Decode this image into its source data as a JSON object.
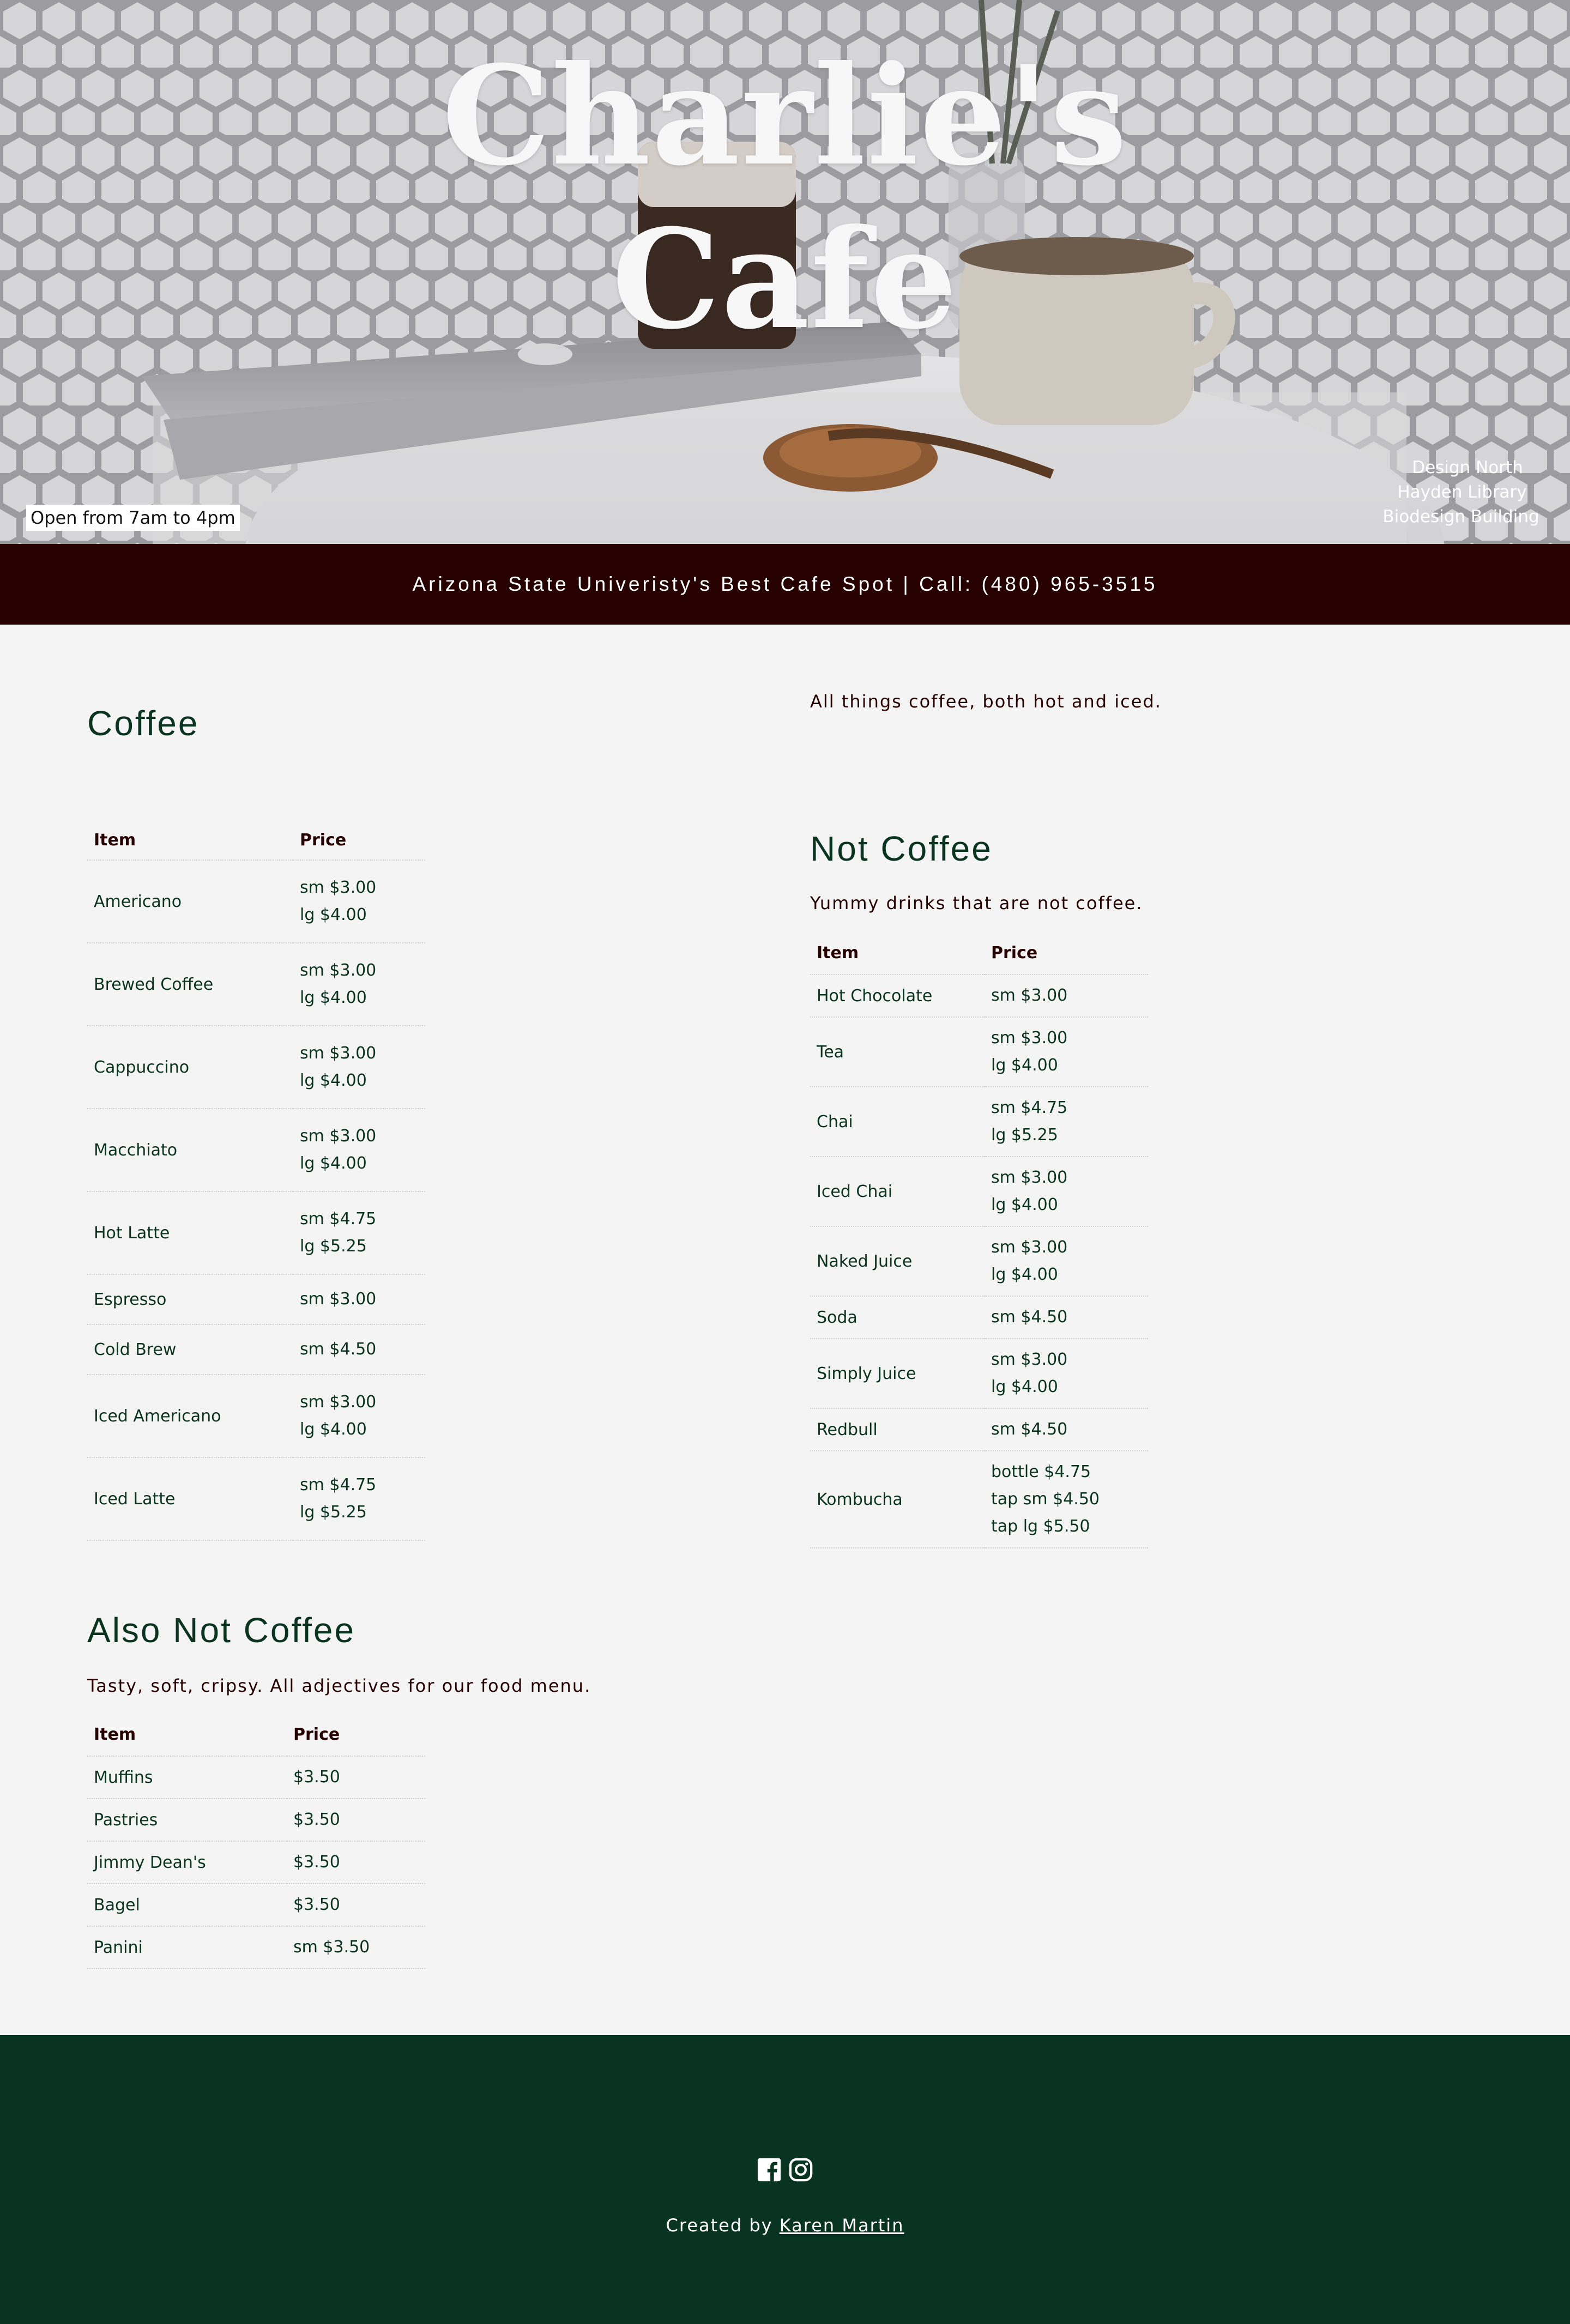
{
  "hero": {
    "title_line1": "Charlie's",
    "title_line2": "Cafe",
    "hours": "Open from 7am to 4pm",
    "locations": [
      "Design North",
      "Hayden Library",
      "Biodesign Building"
    ]
  },
  "banner": {
    "text": "Arizona State Univeristy's Best Cafe Spot | Call: (480) 965-3515"
  },
  "coffee": {
    "heading": "Coffee",
    "description": "All things coffee, both hot and iced.",
    "col_item": "Item",
    "col_price": "Price",
    "rows": [
      {
        "item": "Americano",
        "prices": [
          "sm $3.00",
          "lg $4.00"
        ]
      },
      {
        "item": "Brewed Coffee",
        "prices": [
          "sm $3.00",
          "lg $4.00"
        ]
      },
      {
        "item": "Cappuccino",
        "prices": [
          "sm $3.00",
          "lg $4.00"
        ]
      },
      {
        "item": "Macchiato",
        "prices": [
          "sm $3.00",
          "lg $4.00"
        ]
      },
      {
        "item": "Hot Latte",
        "prices": [
          "sm $4.75",
          "lg $5.25"
        ]
      },
      {
        "item": "Espresso",
        "prices": [
          "sm $3.00"
        ]
      },
      {
        "item": "Cold Brew",
        "prices": [
          "sm $4.50"
        ]
      },
      {
        "item": "Iced Americano",
        "prices": [
          "sm $3.00",
          "lg $4.00"
        ]
      },
      {
        "item": "Iced Latte",
        "prices": [
          "sm $4.75",
          "lg $5.25"
        ]
      }
    ]
  },
  "not_coffee": {
    "heading": "Not Coffee",
    "description": "Yummy drinks that are not coffee.",
    "col_item": "Item",
    "col_price": "Price",
    "rows": [
      {
        "item": "Hot Chocolate",
        "prices": [
          "sm $3.00"
        ]
      },
      {
        "item": "Tea",
        "prices": [
          "sm $3.00",
          "lg $4.00"
        ]
      },
      {
        "item": "Chai",
        "prices": [
          "sm $4.75",
          "lg $5.25"
        ]
      },
      {
        "item": "Iced Chai",
        "prices": [
          "sm $3.00",
          "lg $4.00"
        ]
      },
      {
        "item": "Naked Juice",
        "prices": [
          "sm $3.00",
          "lg $4.00"
        ]
      },
      {
        "item": "Soda",
        "prices": [
          "sm $4.50"
        ]
      },
      {
        "item": "Simply Juice",
        "prices": [
          "sm $3.00",
          "lg $4.00"
        ]
      },
      {
        "item": "Redbull",
        "prices": [
          "sm $4.50"
        ]
      },
      {
        "item": "Kombucha",
        "prices": [
          "bottle $4.75",
          "tap sm $4.50",
          "tap lg $5.50"
        ]
      }
    ]
  },
  "food": {
    "heading": "Also Not Coffee",
    "description": "Tasty, soft, cripsy. All adjectives for our food menu.",
    "col_item": "Item",
    "col_price": "Price",
    "rows": [
      {
        "item": "Muffins",
        "prices": [
          "$3.50"
        ]
      },
      {
        "item": "Pastries",
        "prices": [
          "$3.50"
        ]
      },
      {
        "item": "Jimmy Dean's",
        "prices": [
          "$3.50"
        ]
      },
      {
        "item": "Bagel",
        "prices": [
          "$3.50"
        ]
      },
      {
        "item": "Panini",
        "prices": [
          "sm $3.50"
        ]
      }
    ]
  },
  "footer": {
    "credit_prefix": "Created by",
    "credit_name": "Karen Martin",
    "icons": [
      "facebook-icon",
      "instagram-icon"
    ]
  },
  "colors": {
    "banner_bg": "#270000",
    "footer_bg": "#093421",
    "heading_text": "#0a3320",
    "page_bg": "#f4f4f4"
  }
}
